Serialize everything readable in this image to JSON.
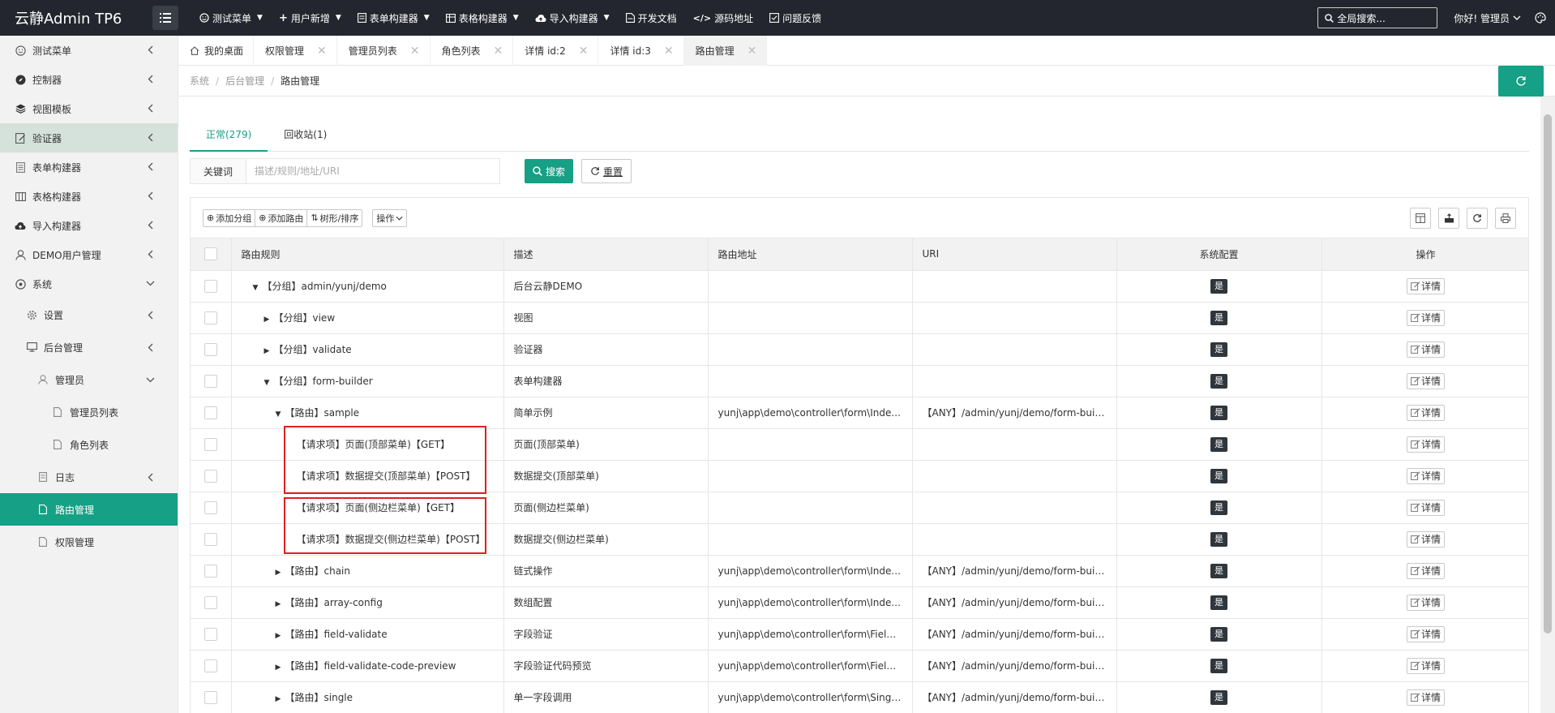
{
  "app": {
    "title": "云静Admin TP6",
    "greeting": "你好! 管理员",
    "search_label": "全局搜索..."
  },
  "top_menu": [
    {
      "label": "测试菜单",
      "icon": "smile-icon",
      "caret": true
    },
    {
      "label": "用户新增",
      "icon": "plus-icon",
      "caret": true
    },
    {
      "label": "表单构建器",
      "icon": "form-icon",
      "caret": true
    },
    {
      "label": "表格构建器",
      "icon": "table-icon",
      "caret": true
    },
    {
      "label": "导入构建器",
      "icon": "cloud-upload-icon",
      "caret": true
    },
    {
      "label": "开发文档",
      "icon": "doc-icon",
      "caret": false
    },
    {
      "label": "源码地址",
      "icon": "code-icon",
      "caret": false
    },
    {
      "label": "问题反馈",
      "icon": "feedback-icon",
      "caret": false
    }
  ],
  "sidebar": {
    "items": [
      {
        "label": "测试菜单"
      },
      {
        "label": "控制器"
      },
      {
        "label": "视图模板"
      },
      {
        "label": "验证器"
      },
      {
        "label": "表单构建器"
      },
      {
        "label": "表格构建器"
      },
      {
        "label": "导入构建器"
      },
      {
        "label": "DEMO用户管理"
      },
      {
        "label": "系统"
      },
      {
        "label": "设置"
      },
      {
        "label": "后台管理"
      },
      {
        "label": "管理员"
      },
      {
        "label": "管理员列表"
      },
      {
        "label": "角色列表"
      },
      {
        "label": "日志"
      },
      {
        "label": "路由管理"
      },
      {
        "label": "权限管理"
      }
    ]
  },
  "tabs": [
    {
      "label": "我的桌面",
      "closable": false
    },
    {
      "label": "权限管理",
      "closable": true
    },
    {
      "label": "管理员列表",
      "closable": true
    },
    {
      "label": "角色列表",
      "closable": true
    },
    {
      "label": "详情 id:2",
      "closable": true
    },
    {
      "label": "详情 id:3",
      "closable": true
    },
    {
      "label": "路由管理",
      "closable": true
    }
  ],
  "breadcrumb": [
    "系统",
    "后台管理",
    "路由管理"
  ],
  "status_tabs": [
    {
      "label": "正常(279)"
    },
    {
      "label": "回收站(1)"
    }
  ],
  "search": {
    "keyword_label": "关键词",
    "placeholder": "描述/规则/地址/URI",
    "search_label": "搜索",
    "reset_label": "重置"
  },
  "toolbar": {
    "add_group": "添加分组",
    "add_route": "添加路由",
    "tree_sort": "树形/排序",
    "ops": "操作"
  },
  "table": {
    "headers": [
      "路由规则",
      "描述",
      "路由地址",
      "URI",
      "系统配置",
      "操作"
    ],
    "detail_label": "详情",
    "rows": [
      {
        "rule": "【分组】admin/yunj/demo",
        "desc": "后台云静DEMO",
        "addr": "",
        "uri": "",
        "sys": "是"
      },
      {
        "rule": "【分组】view",
        "desc": "视图",
        "addr": "",
        "uri": "",
        "sys": "是"
      },
      {
        "rule": "【分组】validate",
        "desc": "验证器",
        "addr": "",
        "uri": "",
        "sys": "是"
      },
      {
        "rule": "【分组】form-builder",
        "desc": "表单构建器",
        "addr": "",
        "uri": "",
        "sys": "是"
      },
      {
        "rule": "【路由】sample",
        "desc": "简单示例",
        "addr": "yunj\\app\\demo\\controller\\form\\IndexCo...",
        "uri": "【ANY】/admin/yunj/demo/form-builde...",
        "sys": "是"
      },
      {
        "rule": "【请求项】页面(顶部菜单)【GET】",
        "desc": "页面(顶部菜单)",
        "addr": "",
        "uri": "",
        "sys": "是"
      },
      {
        "rule": "【请求项】数据提交(顶部菜单)【POST】",
        "desc": "数据提交(顶部菜单)",
        "addr": "",
        "uri": "",
        "sys": "是"
      },
      {
        "rule": "【请求项】页面(侧边栏菜单)【GET】",
        "desc": "页面(侧边栏菜单)",
        "addr": "",
        "uri": "",
        "sys": "是"
      },
      {
        "rule": "【请求项】数据提交(侧边栏菜单)【POST】",
        "desc": "数据提交(侧边栏菜单)",
        "addr": "",
        "uri": "",
        "sys": "是"
      },
      {
        "rule": "【路由】chain",
        "desc": "链式操作",
        "addr": "yunj\\app\\demo\\controller\\form\\IndexCo...",
        "uri": "【ANY】/admin/yunj/demo/form-builde...",
        "sys": "是"
      },
      {
        "rule": "【路由】array-config",
        "desc": "数组配置",
        "addr": "yunj\\app\\demo\\controller\\form\\IndexCo...",
        "uri": "【ANY】/admin/yunj/demo/form-builde...",
        "sys": "是"
      },
      {
        "rule": "【路由】field-validate",
        "desc": "字段验证",
        "addr": "yunj\\app\\demo\\controller\\form\\FieldVali...",
        "uri": "【ANY】/admin/yunj/demo/form-builde...",
        "sys": "是"
      },
      {
        "rule": "【路由】field-validate-code-preview",
        "desc": "字段验证代码预览",
        "addr": "yunj\\app\\demo\\controller\\form\\FieldVali...",
        "uri": "【ANY】/admin/yunj/demo/form-builde...",
        "sys": "是"
      },
      {
        "rule": "【路由】single",
        "desc": "单一字段调用",
        "addr": "yunj\\app\\demo\\controller\\form\\SingleC...",
        "uri": "【ANY】/admin/yunj/demo/form-builde...",
        "sys": "是"
      }
    ]
  },
  "colors": {
    "primary": "#16a085",
    "header_bg": "#23262e",
    "highlight_box": "#e02020",
    "badge_bg": "#2f363c"
  }
}
